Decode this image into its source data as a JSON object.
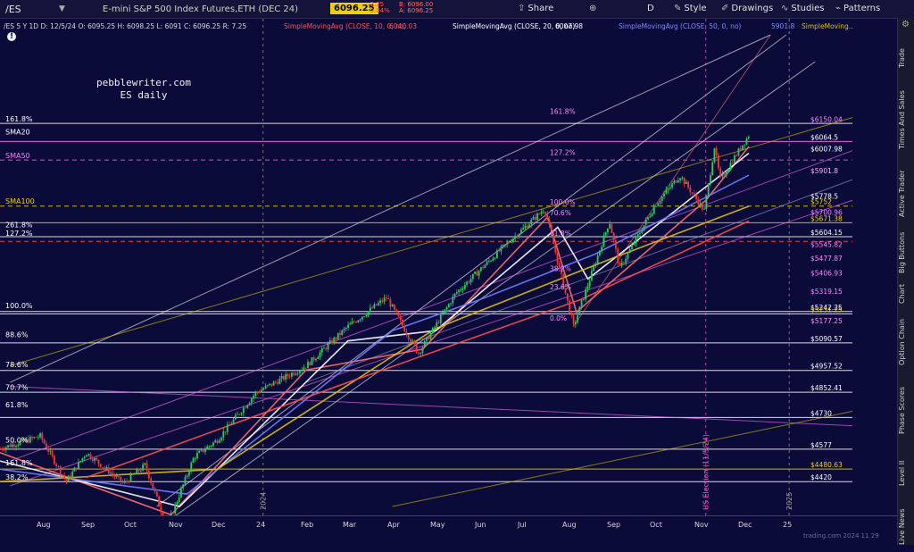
{
  "toolbar": {
    "symbol": "/ES",
    "description": "E-mini S&P 500 Index Futures,ETH (DEC 24)",
    "last_price": "6096.25",
    "change": "-2.25",
    "change_pct": "-0.04%",
    "bid": "B: 6096.00",
    "ask": "A: 6096.25",
    "share_label": "Share",
    "d_label": "D",
    "style_label": "Style",
    "drawings_label": "Drawings",
    "studies_label": "Studies",
    "patterns_label": "Patterns"
  },
  "header": {
    "quote_text": "/ES 5 Y 1D   D: 12/5/24   O: 6095.25   H: 6098.25   L: 6091   C: 6096.25   R: 7.25",
    "sma10_label": "SimpleMovingAvg (CLOSE, 10, 0, no)",
    "sma10_value": "6040.03",
    "sma20_label": "SimpleMovingAvg (CLOSE, 20, 0, no)",
    "sma20_value": "6007.98",
    "sma50_label": "SimpleMovingAvg (CLOSE, 50, 0, no)",
    "sma50_value": "5901.8",
    "sma100_label": "SimpleMoving..."
  },
  "watermark": {
    "line1": "pebblewriter.com",
    "line2": "ES daily"
  },
  "right_tabs": [
    "Trade",
    "Times And Sales",
    "Active Trader",
    "Big Buttons",
    "Chart",
    "Option Chain",
    "Phase Scores",
    "Level II",
    "Live News"
  ],
  "chart_data": {
    "type": "candlestick",
    "y_range": [
      4300,
      6580
    ],
    "y_ticks": [
      "6493.82",
      "6378.04",
      "6264.34",
      "6152.65",
      "6042.96",
      "5935.27",
      "5829.62",
      "5725.99",
      "5623.41",
      "5523.16",
      "5424.69",
      "5327.98",
      "5232.99",
      "5139.70",
      "5048.09",
      "4958.07",
      "4869.68",
      "4782.86",
      "4697.59",
      "4613.84",
      "4531.58",
      "4450.79",
      "4371.44"
    ],
    "x_ticks": [
      {
        "label": "Aug",
        "date": "2023-08-01"
      },
      {
        "label": "Sep",
        "date": "2023-09-01"
      },
      {
        "label": "Oct",
        "date": "2023-10-01"
      },
      {
        "label": "Nov",
        "date": "2023-11-01"
      },
      {
        "label": "Dec",
        "date": "2023-12-01"
      },
      {
        "label": "24",
        "date": "2024-01-01"
      },
      {
        "label": "Feb",
        "date": "2024-02-01"
      },
      {
        "label": "Mar",
        "date": "2024-03-01"
      },
      {
        "label": "Apr",
        "date": "2024-04-01"
      },
      {
        "label": "May",
        "date": "2024-05-01"
      },
      {
        "label": "Jun",
        "date": "2024-06-01"
      },
      {
        "label": "Jul",
        "date": "2024-07-01"
      },
      {
        "label": "Aug",
        "date": "2024-08-01"
      },
      {
        "label": "Sep",
        "date": "2024-09-01"
      },
      {
        "label": "Oct",
        "date": "2024-10-01"
      },
      {
        "label": "Nov",
        "date": "2024-11-01"
      },
      {
        "label": "Dec",
        "date": "2024-12-01"
      },
      {
        "label": "25",
        "date": "2025-01-01"
      }
    ],
    "x_range": [
      "2023-07-03",
      "2025-02-15"
    ],
    "price_path": [
      [
        "2023-07-03",
        4580
      ],
      [
        "2023-07-31",
        4640
      ],
      [
        "2023-08-18",
        4420
      ],
      [
        "2023-09-01",
        4560
      ],
      [
        "2023-09-27",
        4410
      ],
      [
        "2023-10-12",
        4500
      ],
      [
        "2023-10-27",
        4200
      ],
      [
        "2023-11-15",
        4540
      ],
      [
        "2023-12-01",
        4620
      ],
      [
        "2023-12-28",
        4850
      ],
      [
        "2024-02-01",
        4980
      ],
      [
        "2024-03-01",
        5170
      ],
      [
        "2024-03-28",
        5310
      ],
      [
        "2024-04-19",
        5040
      ],
      [
        "2024-05-15",
        5330
      ],
      [
        "2024-06-18",
        5560
      ],
      [
        "2024-07-16",
        5740
      ],
      [
        "2024-08-05",
        5170
      ],
      [
        "2024-08-30",
        5680
      ],
      [
        "2024-09-06",
        5450
      ],
      [
        "2024-10-01",
        5760
      ],
      [
        "2024-10-18",
        5900
      ],
      [
        "2024-11-04",
        5730
      ],
      [
        "2024-11-11",
        6040
      ],
      [
        "2024-11-15",
        5880
      ],
      [
        "2024-12-05",
        6096.25
      ]
    ],
    "moving_averages": [
      {
        "name": "SMA10",
        "color": "#ff6e6e",
        "path": [
          [
            "2023-07-03",
            4560
          ],
          [
            "2023-10-30",
            4260
          ],
          [
            "2024-02-01",
            4960
          ],
          [
            "2024-04-22",
            5060
          ],
          [
            "2024-07-18",
            5700
          ],
          [
            "2024-08-07",
            5240
          ],
          [
            "2024-11-05",
            5780
          ],
          [
            "2024-12-05",
            6040.03
          ]
        ]
      },
      {
        "name": "SMA20",
        "color": "#ffffff",
        "path": [
          [
            "2023-07-03",
            4520
          ],
          [
            "2023-11-05",
            4300
          ],
          [
            "2024-03-01",
            5100
          ],
          [
            "2024-05-01",
            5150
          ],
          [
            "2024-07-25",
            5650
          ],
          [
            "2024-08-15",
            5400
          ],
          [
            "2024-12-05",
            6007.98
          ]
        ]
      },
      {
        "name": "SMA50",
        "color": "#6e7dff",
        "path": [
          [
            "2023-07-03",
            4480
          ],
          [
            "2023-11-10",
            4360
          ],
          [
            "2024-04-01",
            5150
          ],
          [
            "2024-06-01",
            5300
          ],
          [
            "2024-08-20",
            5520
          ],
          [
            "2024-12-05",
            5901.8
          ]
        ]
      },
      {
        "name": "SMA100",
        "color": "#e0c000",
        "path": [
          [
            "2023-07-03",
            4420
          ],
          [
            "2023-12-01",
            4480
          ],
          [
            "2024-05-01",
            5160
          ],
          [
            "2024-09-01",
            5500
          ],
          [
            "2024-12-05",
            5751.48
          ]
        ]
      },
      {
        "name": "SMA200",
        "color": "#ff4d4d",
        "path": [
          [
            "2023-09-01",
            4440
          ],
          [
            "2024-03-01",
            4900
          ],
          [
            "2024-08-10",
            5300
          ],
          [
            "2024-12-05",
            5680
          ]
        ]
      }
    ],
    "fib_left_labels": [
      {
        "label": "161.8%",
        "y": 6152
      },
      {
        "label": "SMA20",
        "y": 6090
      },
      {
        "label": "SMA50",
        "y": 5975
      },
      {
        "label": "SMA100",
        "y": 5755
      },
      {
        "label": "261.8%",
        "y": 5640
      },
      {
        "label": "127.2%",
        "y": 5600
      },
      {
        "label": "100.0%",
        "y": 5250
      },
      {
        "label": "88.6%",
        "y": 5110
      },
      {
        "label": "78.6%",
        "y": 4965
      },
      {
        "label": "70.7%",
        "y": 4855
      },
      {
        "label": "61.8%",
        "y": 4770
      },
      {
        "label": "50.0%",
        "y": 4600
      },
      {
        "label": "161.8%",
        "y": 4490
      },
      {
        "label": "38.2%",
        "y": 4420
      }
    ],
    "fib_inner_labels": [
      {
        "label": "161.8%",
        "y": 6190
      },
      {
        "label": "127.2%",
        "y": 5990
      },
      {
        "label": "100.0%",
        "y": 5750
      },
      {
        "label": "70.6%",
        "y": 5700
      },
      {
        "label": "61.8%",
        "y": 5600
      },
      {
        "label": "38.2%",
        "y": 5430
      },
      {
        "label": "23.6%",
        "y": 5340
      },
      {
        "label": "0.0%",
        "y": 5190
      }
    ],
    "level_labels": [
      {
        "label": "$6150.04",
        "y": 6150,
        "color": "#ff88ff"
      },
      {
        "label": "$6064.5",
        "y": 6064.5,
        "color": "#ffffff"
      },
      {
        "label": "$6007.98",
        "y": 6007.98,
        "color": "#ffffff"
      },
      {
        "label": "$5901.8",
        "y": 5901.8,
        "color": "#ffaaff"
      },
      {
        "label": "$5778.5",
        "y": 5778.5,
        "color": "#ffffff"
      },
      {
        "label": "$5752",
        "y": 5752,
        "color": "#f0d000"
      },
      {
        "label": "$5700.96",
        "y": 5700.96,
        "color": "#ff88ff"
      },
      {
        "label": "$5671.38",
        "y": 5671.38,
        "color": "#f0d000"
      },
      {
        "label": "$5604.15",
        "y": 5604.15,
        "color": "#ffffff"
      },
      {
        "label": "$5545.82",
        "y": 5545.82,
        "color": "#ff88ff"
      },
      {
        "label": "$5477.87",
        "y": 5477.87,
        "color": "#ff88ff"
      },
      {
        "label": "$5406.93",
        "y": 5406.93,
        "color": "#ff88ff"
      },
      {
        "label": "$5319.15",
        "y": 5319.15,
        "color": "#ff88ff"
      },
      {
        "label": "$5242.25",
        "y": 5242.25,
        "color": "#ffffff"
      },
      {
        "label": "$5231.25",
        "y": 5231.25,
        "color": "#f0d000"
      },
      {
        "label": "$5177.25",
        "y": 5177.25,
        "color": "#ff88ff"
      },
      {
        "label": "$5090.57",
        "y": 5090.57,
        "color": "#ffffff"
      },
      {
        "label": "$4957.52",
        "y": 4957.52,
        "color": "#ffffff"
      },
      {
        "label": "$4852.41",
        "y": 4852.41,
        "color": "#ffffff"
      },
      {
        "label": "$4730",
        "y": 4730,
        "color": "#ffffff"
      },
      {
        "label": "$4577",
        "y": 4577,
        "color": "#ffffff"
      },
      {
        "label": "$4480.63",
        "y": 4480.63,
        "color": "#f0d000"
      },
      {
        "label": "$4420",
        "y": 4420,
        "color": "#ffffff"
      }
    ],
    "horizontal_lines": [
      {
        "y": 6152,
        "color": "#ffffff",
        "dash": false
      },
      {
        "y": 6064.5,
        "color": "#ff7bff",
        "dash": false
      },
      {
        "y": 5975,
        "color": "#ff5bd0",
        "dash": true
      },
      {
        "y": 5752,
        "color": "#f0d000",
        "dash": true
      },
      {
        "y": 5671.38,
        "color": "#f0d000",
        "dash": false
      },
      {
        "y": 5604.15,
        "color": "#ffffff",
        "dash": false
      },
      {
        "y": 5581.61,
        "color": "#ff5050",
        "dash": true
      },
      {
        "y": 5242.25,
        "color": "#ffffff",
        "dash": false
      },
      {
        "y": 5231.25,
        "color": "#ffffff",
        "dash": false
      },
      {
        "y": 5090.57,
        "color": "#ffffff",
        "dash": false
      },
      {
        "y": 4957.52,
        "color": "#ffffff",
        "dash": false
      },
      {
        "y": 4852.41,
        "color": "#ffffff",
        "dash": false
      },
      {
        "y": 4730,
        "color": "#ffffff",
        "dash": false
      },
      {
        "y": 4577,
        "color": "#ffffff",
        "dash": false
      },
      {
        "y": 4480.63,
        "color": "#f0d000",
        "dash": false
      },
      {
        "y": 4420,
        "color": "#ffffff",
        "dash": false
      }
    ],
    "price_badges": [
      {
        "label": "6096.25",
        "y": 6096.25,
        "bg": "#f0d000",
        "fg": "#000000"
      },
      {
        "label": "6007.98",
        "y": 6007.98,
        "bg": "#ffffff",
        "fg": "#000000"
      },
      {
        "label": "5901.8",
        "y": 5901.8,
        "bg": "#5a6dff",
        "fg": "#ffffff"
      },
      {
        "label": "5751.48",
        "y": 5751.48,
        "bg": "#f0d000",
        "fg": "#000000"
      },
      {
        "label": "5581.61",
        "y": 5581.61,
        "bg": "#ff4040",
        "fg": "#ffffff"
      }
    ],
    "vertical_annotations": [
      {
        "label": "US Election (11/5/24)",
        "date": "2024-11-05",
        "color": "#ff5bd0"
      },
      {
        "label": "2024",
        "date": "2024-01-02",
        "color": "#a0a0a0"
      },
      {
        "label": "2025",
        "date": "2025-01-02",
        "color": "#a0a0a0"
      }
    ],
    "date_label": "",
    "watermark_bottom": "trading.com 2024 11 29"
  }
}
